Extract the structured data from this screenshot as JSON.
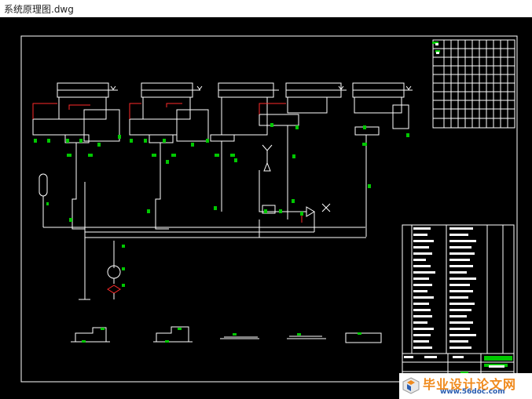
{
  "window": {
    "title": "系统原理图.dwg"
  },
  "colors": {
    "background": "#000000",
    "line": "#ffffff",
    "highlight": "#00c800",
    "accent": "#ff2a2a"
  },
  "watermark": {
    "brand": "毕业设计论文网",
    "url": "www.56doc.com"
  },
  "icons": [
    "drawing-canvas",
    "watermark-logo-icon"
  ]
}
